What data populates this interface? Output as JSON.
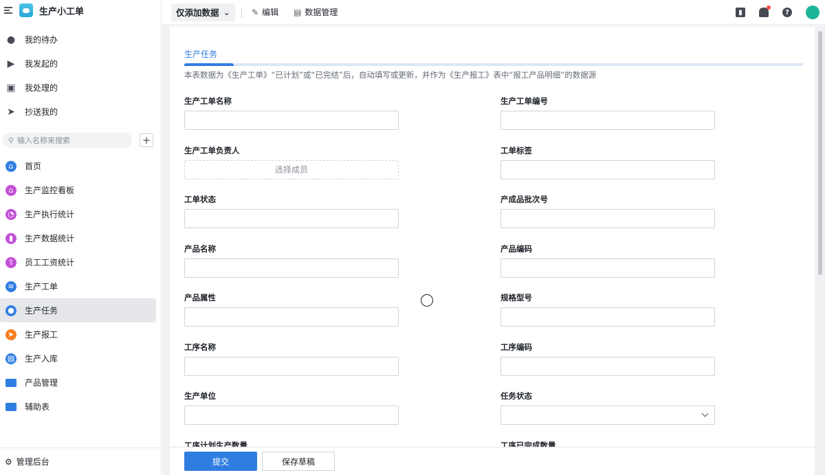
{
  "app": {
    "title": "生产小工单"
  },
  "sidebar": {
    "personal": [
      {
        "label": "我的待办",
        "icon": "bell-icon"
      },
      {
        "label": "我发起的",
        "icon": "play-icon"
      },
      {
        "label": "我处理的",
        "icon": "inbox-icon"
      },
      {
        "label": "抄送我的",
        "icon": "send-icon"
      }
    ],
    "search_placeholder": "输入名称来搜索",
    "items": [
      {
        "label": "首页",
        "icon": "home-icon",
        "color": "#2f7de1"
      },
      {
        "label": "生产监控看板",
        "icon": "home-icon",
        "color": "#c24fd6"
      },
      {
        "label": "生产执行统计",
        "icon": "pie-chart-icon",
        "color": "#c24fd6"
      },
      {
        "label": "生产数据统计",
        "icon": "bar-chart-icon",
        "color": "#c24fd6"
      },
      {
        "label": "员工工资统计",
        "icon": "house-up-icon",
        "color": "#c24fd6"
      },
      {
        "label": "生产工单",
        "icon": "document-icon",
        "color": "#2f7de1"
      },
      {
        "label": "生产任务",
        "icon": "target-icon",
        "color": "#2f7de1"
      },
      {
        "label": "生产报工",
        "icon": "send-icon",
        "color": "#f57c1f"
      },
      {
        "label": "生产入库",
        "icon": "clipboard-icon",
        "color": "#2f7de1"
      },
      {
        "label": "产品管理",
        "icon": "folder-icon",
        "color": "#2f7de1"
      },
      {
        "label": "辅助表",
        "icon": "folder-icon",
        "color": "#2f7de1"
      }
    ],
    "admin": "管理后台"
  },
  "toolbar": {
    "view": "仅添加数据",
    "edit": "编辑",
    "data_manage": "数据管理"
  },
  "form": {
    "section": "生产任务",
    "progress": 0.08,
    "description": "本表数据为《生产工单》“已计划”或“已完结”后，自动填写或更新，并作为《生产报工》表中“报工产品明细”的数据源",
    "member_placeholder": "选择成员",
    "left": [
      "生产工单名称",
      "生产工单负责人",
      "工单状态",
      "产品名称",
      "产品属性",
      "工序名称",
      "生产单位",
      "工序计划生产数量"
    ],
    "right": [
      "生产工单编号",
      "工单标签",
      "产成品批次号",
      "产品编码",
      "规格型号",
      "工序编码",
      "任务状态",
      "工序已完成数量"
    ],
    "submit": "提交",
    "save_draft": "保存草稿"
  }
}
